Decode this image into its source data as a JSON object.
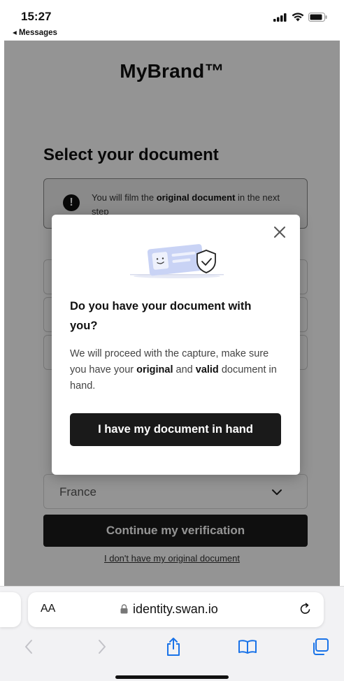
{
  "status_bar": {
    "time": "15:27",
    "back_app": "◂ Messages",
    "icons": [
      "cellular-signal-icon",
      "wifi-icon",
      "battery-icon"
    ]
  },
  "page": {
    "brand": "MyBrand™",
    "section_title": "Select your document",
    "info_box": {
      "icon": "exclamation-icon",
      "text_before": "You will film the ",
      "text_bold": "original document",
      "text_after": " in the next step"
    },
    "country_select": {
      "value": "France",
      "icon": "chevron-down-icon"
    },
    "continue_button": "Continue my verification",
    "no_document_link": "I don't have my original document"
  },
  "modal": {
    "close_icon": "close-icon",
    "illustration": "id-card-shield-illustration",
    "title": "Do you have your document with you?",
    "body": {
      "part1": "We will proceed with the capture, make sure you have your ",
      "bold1": "original",
      "part2": " and ",
      "bold2": "valid",
      "part3": " document in hand."
    },
    "primary_button": "I have my document in hand"
  },
  "browser": {
    "aa_label": "AA",
    "url": "identity.swan.io",
    "icons": [
      "lock-icon",
      "reload-icon",
      "back-icon",
      "forward-icon",
      "share-icon",
      "bookmarks-icon",
      "tabs-icon"
    ]
  },
  "colors": {
    "primary_button": "#1a1a1a",
    "overlay": "rgba(0,0,0,0.42)",
    "illustration_accent": "#c9d3f5"
  }
}
